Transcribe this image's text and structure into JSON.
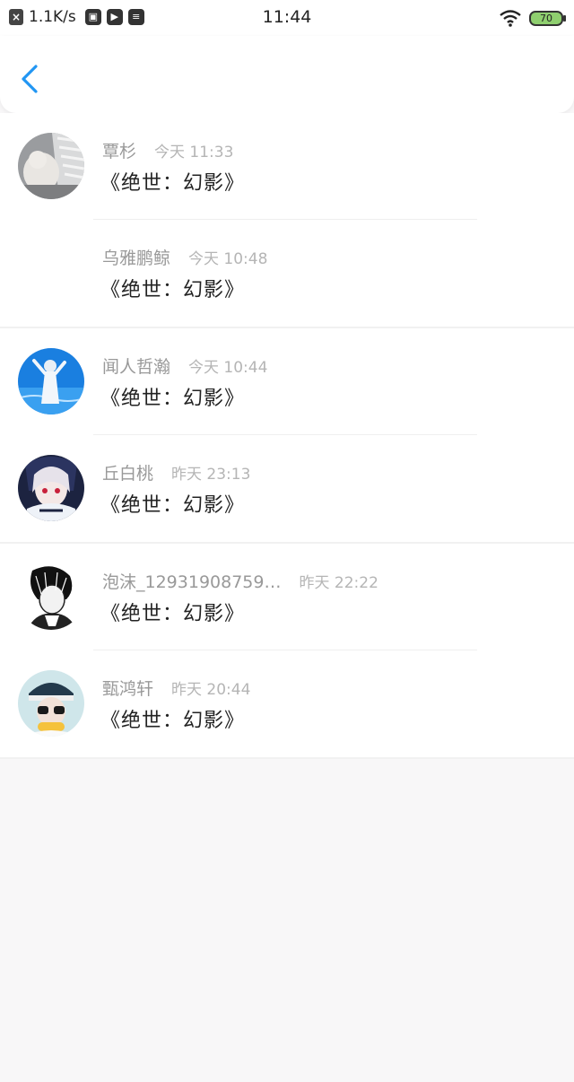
{
  "status_bar": {
    "close_glyph": "×",
    "net_speed": "1.1K/s",
    "time": "11:44",
    "battery": "70"
  },
  "header": {
    "back_icon": "chevron-left-icon",
    "accent_color": "#2196f3"
  },
  "comments": [
    {
      "name": "覃杉",
      "time": "今天 11:33",
      "title": "《绝世：幻影》",
      "has_avatar": true
    },
    {
      "name": "乌雅鹏鲸",
      "time": "今天 10:48",
      "title": "《绝世：幻影》",
      "has_avatar": false
    },
    {
      "name": "闻人哲瀚",
      "time": "今天 10:44",
      "title": "《绝世：幻影》",
      "has_avatar": true
    },
    {
      "name": "丘白桃",
      "time": "昨天 23:13",
      "title": "《绝世：幻影》",
      "has_avatar": true
    },
    {
      "name": "泡沫_12931908759…",
      "time": "昨天 22:22",
      "title": "《绝世：幻影》",
      "has_avatar": true
    },
    {
      "name": "甄鸿轩",
      "time": "昨天 20:44",
      "title": "《绝世：幻影》",
      "has_avatar": true
    }
  ]
}
